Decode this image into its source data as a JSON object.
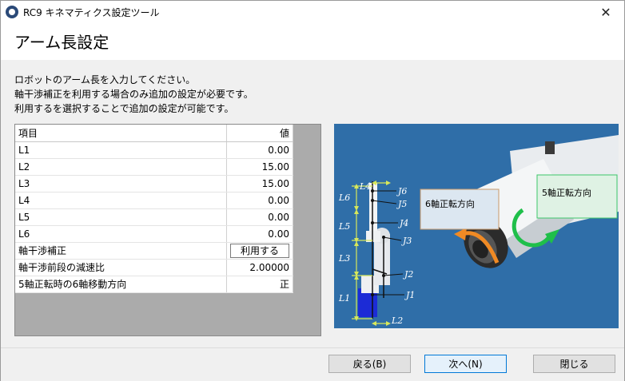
{
  "window": {
    "title": "RC9 キネマティクス設定ツール",
    "close_glyph": "✕"
  },
  "page": {
    "title": "アーム長設定",
    "description": [
      "ロボットのアーム長を入力してください。",
      "軸干渉補正を利用する場合のみ追加の設定が必要です。",
      "利用するを選択することで追加の設定が可能です。"
    ]
  },
  "grid": {
    "headers": {
      "item": "項目",
      "value": "値"
    },
    "rows": [
      {
        "name": "L1",
        "value": "0.00"
      },
      {
        "name": "L2",
        "value": "15.00"
      },
      {
        "name": "L3",
        "value": "15.00"
      },
      {
        "name": "L4",
        "value": "0.00"
      },
      {
        "name": "L5",
        "value": "0.00"
      },
      {
        "name": "L6",
        "value": "0.00"
      },
      {
        "name": "軸干渉補正",
        "value": "利用する"
      },
      {
        "name": "軸干渉前段の減速比",
        "value": "2.00000"
      },
      {
        "name": "5軸正転時の6軸移動方向",
        "value": "正"
      }
    ]
  },
  "diagram": {
    "labels": {
      "L1": "L1",
      "L2": "L2",
      "L3": "L3",
      "L4": "L4",
      "L5": "L5",
      "L6": "L6",
      "J1": "J1",
      "J2": "J2",
      "J3": "J3",
      "J4": "J4",
      "J5": "J5",
      "J6": "J6"
    },
    "callout_6": "6軸正転方向",
    "callout_5": "5軸正転方向",
    "colors": {
      "background": "#2f6ea8",
      "arrow_orange": "#f08a24",
      "arrow_green": "#1fbf4a",
      "dim_line": "#d8e85a"
    }
  },
  "buttons": {
    "back": "戻る(B)",
    "next": "次へ(N)",
    "close": "閉じる"
  }
}
